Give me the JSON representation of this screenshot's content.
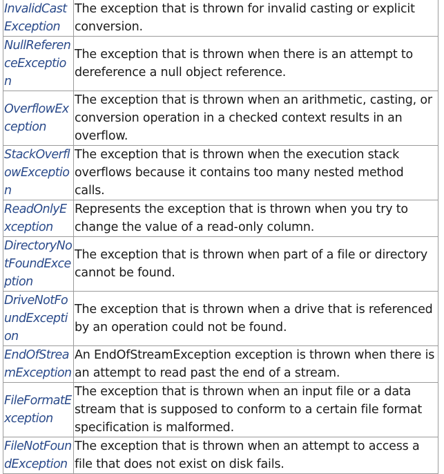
{
  "rows": [
    {
      "name": "InvalidCastException",
      "description": "The exception that is thrown for invalid casting or explicit conversion."
    },
    {
      "name": "NullReferenceException",
      "description": "The exception that is thrown when there is an attempt to dereference a null object reference."
    },
    {
      "name": "OverflowException",
      "description": "The exception that is thrown when an arithmetic, casting, or conversion operation in a checked context results in an overflow."
    },
    {
      "name": "StackOverflowException",
      "description": "The exception that is thrown when the execution stack overflows because it contains too many nested method calls."
    },
    {
      "name": "ReadOnlyException",
      "description": "Represents the exception that is thrown when you try to change the value of a read-only column."
    },
    {
      "name": "DirectoryNotFoundException",
      "description": "The exception that is thrown when part of a file or directory cannot be found."
    },
    {
      "name": "DriveNotFoundException",
      "description": "The exception that is thrown when a drive that is referenced by an operation could not be found."
    },
    {
      "name": "EndOfStreamException",
      "description": "An EndOfStreamException exception is thrown when there is an attempt to read past the end of a stream."
    },
    {
      "name": "FileFormatException",
      "description": "The exception that is thrown when an input file or a data stream that is supposed to conform to a certain file format specification is malformed."
    },
    {
      "name": "FileNotFoundException",
      "description": "The exception that is thrown when an attempt to access a file that does not exist on disk fails."
    }
  ]
}
